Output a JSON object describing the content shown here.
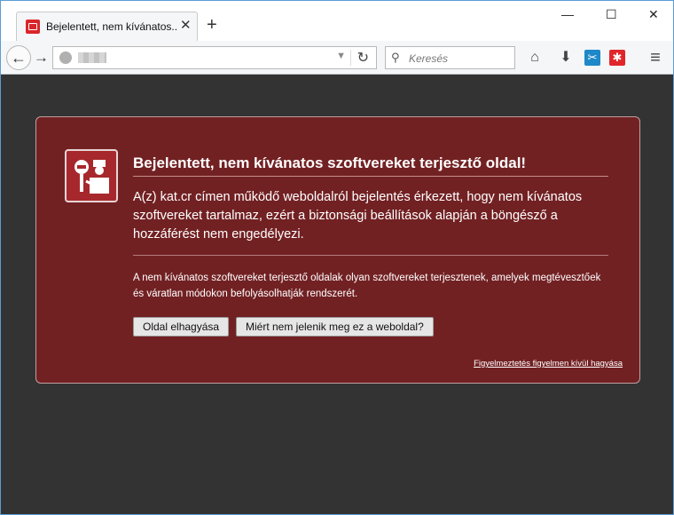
{
  "tab": {
    "title": "Bejelentett, nem kívánatos...",
    "close": "✕"
  },
  "newtab": "+",
  "window_controls": {
    "minimize": "—",
    "maximize": "☐",
    "close": "✕"
  },
  "nav": {
    "back": "←",
    "forward": "→",
    "dropdown": "▼",
    "reload": "↻",
    "search_placeholder": "Keresés",
    "search_icon": "⚲",
    "icons": [
      "home-icon",
      "download-icon",
      "extension-blue-icon",
      "extension-red-icon",
      "menu-icon"
    ],
    "glyphs": {
      "home": "⌂",
      "download": "⬇",
      "ext_blue": "✂",
      "ext_red": "✱",
      "menu": "≡"
    },
    "colors": {
      "ext_blue": "#1e88c8",
      "ext_red": "#e0262b"
    }
  },
  "warning": {
    "title": "Bejelentett, nem kívánatos szoftvereket terjesztő oldal!",
    "description": "A(z) kat.cr címen működő weboldalról bejelentés érkezett, hogy nem kívánatos szoftvereket tartalmaz, ezért a biztonsági beállítások alapján a böngésző a hozzáférést nem engedélyezi.",
    "note": "A nem kívánatos szoftvereket terjesztő oldalak olyan szoftvereket terjesztenek, amelyek megtévesztőek és váratlan módokon befolyásolhatják rendszerét.",
    "leave_button": "Oldal elhagyása",
    "why_button": "Miért nem jelenik meg ez a weboldal?",
    "ignore_link": "Figyelmeztetés figyelmen kívül hagyása",
    "colors": {
      "panel": "#722123",
      "badge": "#a7282c",
      "background": "#333333"
    }
  }
}
